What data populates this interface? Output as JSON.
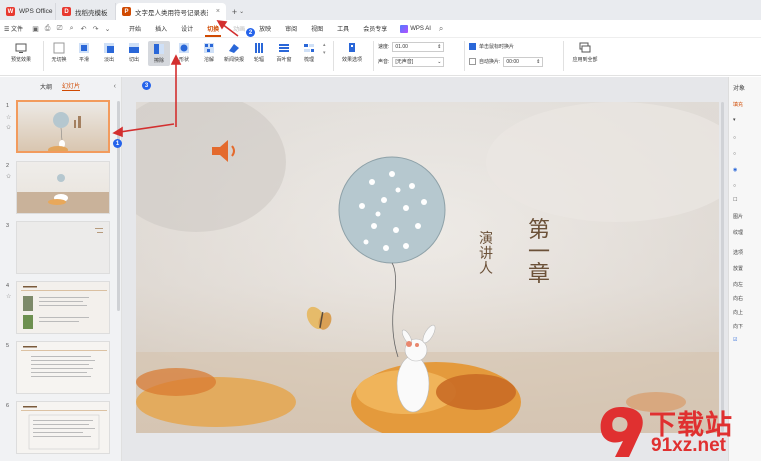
{
  "tabs": [
    {
      "label": "WPS Office",
      "logo_color": "#e8392f"
    },
    {
      "label": "找稻壳模板",
      "logo_color": "#e8392f"
    },
    {
      "label": "文字是人类用符号记录表达信息以",
      "logo_color": "#d04a02"
    }
  ],
  "menubar": {
    "file": "☰ 文件",
    "items": [
      "开始",
      "插入",
      "设计",
      "切换",
      "动画",
      "放映",
      "审阅",
      "视图",
      "工具",
      "会员专享"
    ],
    "active_index": 3,
    "ai_label": "WPS AI"
  },
  "ribbon": {
    "preview": "预览效果",
    "effects": [
      "无切换",
      "平滑",
      "淡出",
      "切出",
      "擦除",
      "形状",
      "溶解",
      "新闻快报",
      "轮辐",
      "百叶窗",
      "梳理"
    ],
    "selected_effect_index": 4,
    "effect_options": "效果选项",
    "speed_label": "速度:",
    "speed_value": "01.00",
    "sound_label": "声音:",
    "sound_value": "[无声音]",
    "click_advance": "单击鼠标时换片",
    "auto_advance": "自动换片:",
    "auto_time": "00:00",
    "apply_all": "应用到全部"
  },
  "left_panel": {
    "tab_outline": "大纲",
    "tab_slides": "幻灯片",
    "slides": [
      {
        "num": "1"
      },
      {
        "num": "2"
      },
      {
        "num": "3"
      },
      {
        "num": "4"
      },
      {
        "num": "5"
      },
      {
        "num": "6"
      }
    ]
  },
  "slide": {
    "title": "第一章",
    "subtitle": "演讲人"
  },
  "right_panel": {
    "title": "对象",
    "tab": "填充",
    "items": [
      "填",
      "图片",
      "纹理",
      "选项",
      "放置",
      "向左",
      "向右",
      "向上",
      "向下"
    ]
  },
  "annotations": [
    "1",
    "2",
    "3"
  ],
  "watermark": {
    "brand": "下载站",
    "url": "91xz.net"
  },
  "colors": {
    "accent": "#d04a02",
    "annotation_arrow": "#d32f2f",
    "badge": "#2563eb"
  }
}
